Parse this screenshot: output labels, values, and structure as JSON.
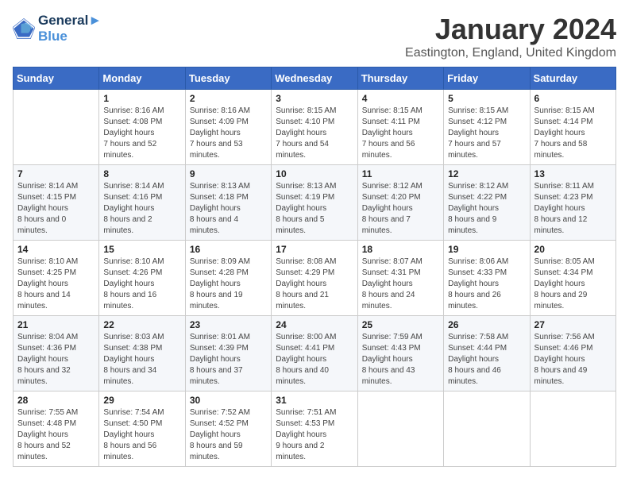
{
  "logo": {
    "line1": "General",
    "line2": "Blue"
  },
  "title": "January 2024",
  "subtitle": "Eastington, England, United Kingdom",
  "headers": [
    "Sunday",
    "Monday",
    "Tuesday",
    "Wednesday",
    "Thursday",
    "Friday",
    "Saturday"
  ],
  "weeks": [
    [
      {
        "day": "",
        "sunrise": "",
        "sunset": "",
        "daylight": ""
      },
      {
        "day": "1",
        "sunrise": "8:16 AM",
        "sunset": "4:08 PM",
        "daylight": "7 hours and 52 minutes."
      },
      {
        "day": "2",
        "sunrise": "8:16 AM",
        "sunset": "4:09 PM",
        "daylight": "7 hours and 53 minutes."
      },
      {
        "day": "3",
        "sunrise": "8:15 AM",
        "sunset": "4:10 PM",
        "daylight": "7 hours and 54 minutes."
      },
      {
        "day": "4",
        "sunrise": "8:15 AM",
        "sunset": "4:11 PM",
        "daylight": "7 hours and 56 minutes."
      },
      {
        "day": "5",
        "sunrise": "8:15 AM",
        "sunset": "4:12 PM",
        "daylight": "7 hours and 57 minutes."
      },
      {
        "day": "6",
        "sunrise": "8:15 AM",
        "sunset": "4:14 PM",
        "daylight": "7 hours and 58 minutes."
      }
    ],
    [
      {
        "day": "7",
        "sunrise": "8:14 AM",
        "sunset": "4:15 PM",
        "daylight": "8 hours and 0 minutes."
      },
      {
        "day": "8",
        "sunrise": "8:14 AM",
        "sunset": "4:16 PM",
        "daylight": "8 hours and 2 minutes."
      },
      {
        "day": "9",
        "sunrise": "8:13 AM",
        "sunset": "4:18 PM",
        "daylight": "8 hours and 4 minutes."
      },
      {
        "day": "10",
        "sunrise": "8:13 AM",
        "sunset": "4:19 PM",
        "daylight": "8 hours and 5 minutes."
      },
      {
        "day": "11",
        "sunrise": "8:12 AM",
        "sunset": "4:20 PM",
        "daylight": "8 hours and 7 minutes."
      },
      {
        "day": "12",
        "sunrise": "8:12 AM",
        "sunset": "4:22 PM",
        "daylight": "8 hours and 9 minutes."
      },
      {
        "day": "13",
        "sunrise": "8:11 AM",
        "sunset": "4:23 PM",
        "daylight": "8 hours and 12 minutes."
      }
    ],
    [
      {
        "day": "14",
        "sunrise": "8:10 AM",
        "sunset": "4:25 PM",
        "daylight": "8 hours and 14 minutes."
      },
      {
        "day": "15",
        "sunrise": "8:10 AM",
        "sunset": "4:26 PM",
        "daylight": "8 hours and 16 minutes."
      },
      {
        "day": "16",
        "sunrise": "8:09 AM",
        "sunset": "4:28 PM",
        "daylight": "8 hours and 19 minutes."
      },
      {
        "day": "17",
        "sunrise": "8:08 AM",
        "sunset": "4:29 PM",
        "daylight": "8 hours and 21 minutes."
      },
      {
        "day": "18",
        "sunrise": "8:07 AM",
        "sunset": "4:31 PM",
        "daylight": "8 hours and 24 minutes."
      },
      {
        "day": "19",
        "sunrise": "8:06 AM",
        "sunset": "4:33 PM",
        "daylight": "8 hours and 26 minutes."
      },
      {
        "day": "20",
        "sunrise": "8:05 AM",
        "sunset": "4:34 PM",
        "daylight": "8 hours and 29 minutes."
      }
    ],
    [
      {
        "day": "21",
        "sunrise": "8:04 AM",
        "sunset": "4:36 PM",
        "daylight": "8 hours and 32 minutes."
      },
      {
        "day": "22",
        "sunrise": "8:03 AM",
        "sunset": "4:38 PM",
        "daylight": "8 hours and 34 minutes."
      },
      {
        "day": "23",
        "sunrise": "8:01 AM",
        "sunset": "4:39 PM",
        "daylight": "8 hours and 37 minutes."
      },
      {
        "day": "24",
        "sunrise": "8:00 AM",
        "sunset": "4:41 PM",
        "daylight": "8 hours and 40 minutes."
      },
      {
        "day": "25",
        "sunrise": "7:59 AM",
        "sunset": "4:43 PM",
        "daylight": "8 hours and 43 minutes."
      },
      {
        "day": "26",
        "sunrise": "7:58 AM",
        "sunset": "4:44 PM",
        "daylight": "8 hours and 46 minutes."
      },
      {
        "day": "27",
        "sunrise": "7:56 AM",
        "sunset": "4:46 PM",
        "daylight": "8 hours and 49 minutes."
      }
    ],
    [
      {
        "day": "28",
        "sunrise": "7:55 AM",
        "sunset": "4:48 PM",
        "daylight": "8 hours and 52 minutes."
      },
      {
        "day": "29",
        "sunrise": "7:54 AM",
        "sunset": "4:50 PM",
        "daylight": "8 hours and 56 minutes."
      },
      {
        "day": "30",
        "sunrise": "7:52 AM",
        "sunset": "4:52 PM",
        "daylight": "8 hours and 59 minutes."
      },
      {
        "day": "31",
        "sunrise": "7:51 AM",
        "sunset": "4:53 PM",
        "daylight": "9 hours and 2 minutes."
      },
      {
        "day": "",
        "sunrise": "",
        "sunset": "",
        "daylight": ""
      },
      {
        "day": "",
        "sunrise": "",
        "sunset": "",
        "daylight": ""
      },
      {
        "day": "",
        "sunrise": "",
        "sunset": "",
        "daylight": ""
      }
    ]
  ]
}
